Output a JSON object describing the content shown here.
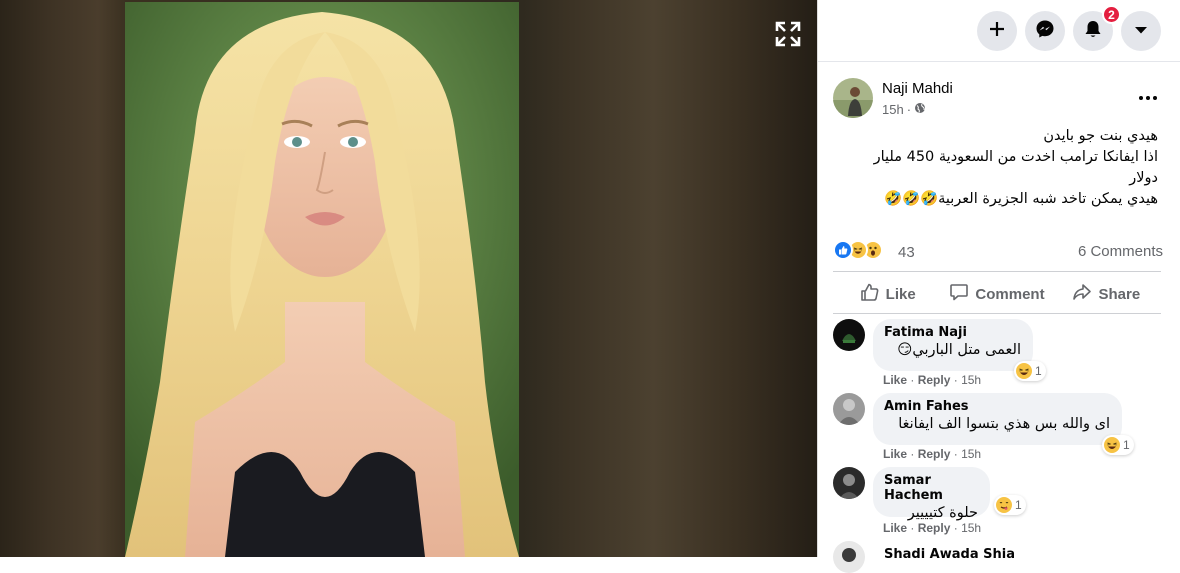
{
  "viewer": {
    "expand_icon": "expand-arrows-icon",
    "colors": {
      "backdrop": "#2a2218",
      "hair": "#f1dc9a",
      "background_foliage": "#5d8a45"
    }
  },
  "topbar": {
    "create_icon": "plus-icon",
    "messenger_icon": "messenger-icon",
    "notifications_icon": "bell-icon",
    "notifications_badge": "2",
    "account_icon": "caret-down-icon"
  },
  "post": {
    "author": "Naji Mahdi",
    "time": "15h",
    "privacy_icon": "globe-icon",
    "more_icon": "ellipsis-icon",
    "text_lines": [
      "هيدي بنت جو بايدن",
      "اذا ايفانكا ترامب اخدت من السعودية 450 مليار دولار",
      "هيدي يمكن تاخد شبه الجزيرة العربية🤣🤣🤣"
    ],
    "reactions": [
      "like",
      "haha",
      "wow"
    ],
    "reaction_count": "43",
    "comments_count": "6 Comments"
  },
  "actions": {
    "like": "Like",
    "comment": "Comment",
    "share": "Share"
  },
  "comments": [
    {
      "name": "Fatima Naji",
      "text": "العمى متل الباربي😏",
      "reaction": "haha",
      "reaction_count": "1",
      "like": "Like",
      "reply": "Reply",
      "time": "15h"
    },
    {
      "name": "Amin Fahes",
      "text": "اى والله بس هذي بتسوا الف ايفانغا",
      "reaction": "haha",
      "reaction_count": "1",
      "like": "Like",
      "reply": "Reply",
      "time": "15h"
    },
    {
      "name": "Samar Hachem",
      "text": "حلوة كتيييير",
      "reaction": "yum",
      "reaction_count": "1",
      "like": "Like",
      "reply": "Reply",
      "time": "15h"
    },
    {
      "name": "Shadi Awada Shia"
    }
  ],
  "separator": "·",
  "colors": {
    "link_blue": "#1877f2",
    "meta_gray": "#65676b",
    "bubble_bg": "#f0f2f5",
    "badge_red": "#e41e3f"
  }
}
